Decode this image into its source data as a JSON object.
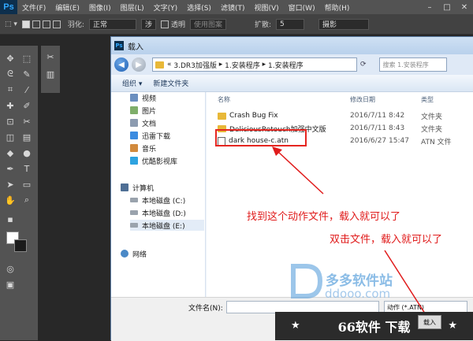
{
  "app": {
    "logo": "Ps",
    "menu": [
      "文件(F)",
      "编辑(E)",
      "图像(I)",
      "图层(L)",
      "文字(Y)",
      "选择(S)",
      "滤镜(T)",
      "视图(V)",
      "窗口(W)",
      "帮助(H)"
    ],
    "window_controls": [
      "–",
      "□",
      "✕"
    ]
  },
  "options_bar": {
    "feather_label": "羽化:",
    "mode_label": "正常",
    "refine_label": "涉",
    "transparent_label": "透明",
    "use_pattern_label": "使用图案",
    "diffusion_label": "扩散:",
    "diffusion_value": "5",
    "workspace": "摄影"
  },
  "dialog": {
    "title": "载入",
    "breadcrumb": [
      "«",
      "3.DR3加强版",
      "1.安装程序",
      "1.安装程序"
    ],
    "search_placeholder": "搜索 1.安装程序",
    "commands": [
      "组织 ▾",
      "新建文件夹"
    ],
    "nav_items": [
      {
        "label": "视频",
        "color": "#6b8fbf"
      },
      {
        "label": "图片",
        "color": "#7fae6a"
      },
      {
        "label": "文档",
        "color": "#8c9bb0"
      },
      {
        "label": "迅雷下载",
        "color": "#3c8ce0"
      },
      {
        "label": "音乐",
        "color": "#d18a3d"
      },
      {
        "label": "优酷影视库",
        "color": "#2ea3e0"
      }
    ],
    "computer_label": "计算机",
    "drives": [
      "本地磁盘 (C:)",
      "本地磁盘 (D:)",
      "本地磁盘 (E:)"
    ],
    "network_label": "网络",
    "columns": {
      "name": "名称",
      "date": "修改日期",
      "type": "类型"
    },
    "files": [
      {
        "name": "Crash Bug Fix",
        "date": "2016/7/11 8:42",
        "type": "文件夹",
        "kind": "folder"
      },
      {
        "name": "DeliciousRetouch加强中文版",
        "date": "2016/7/11 8:43",
        "type": "文件夹",
        "kind": "folder"
      },
      {
        "name": "dark house-c.atn",
        "date": "2016/6/27 15:47",
        "type": "ATN 文件",
        "kind": "atn"
      }
    ],
    "filename_label": "文件名(N):",
    "filter_value": "动作 (*.ATN)",
    "load_button": "载入"
  },
  "annotations": {
    "note1": "找到这个动作文件，载入就可以了",
    "note2": "双击文件，载入就可以了"
  },
  "watermark": {
    "site_name": "多多软件站",
    "url": "ddooo.com"
  },
  "banner": {
    "text": "66软件 下载",
    "star": "★"
  }
}
